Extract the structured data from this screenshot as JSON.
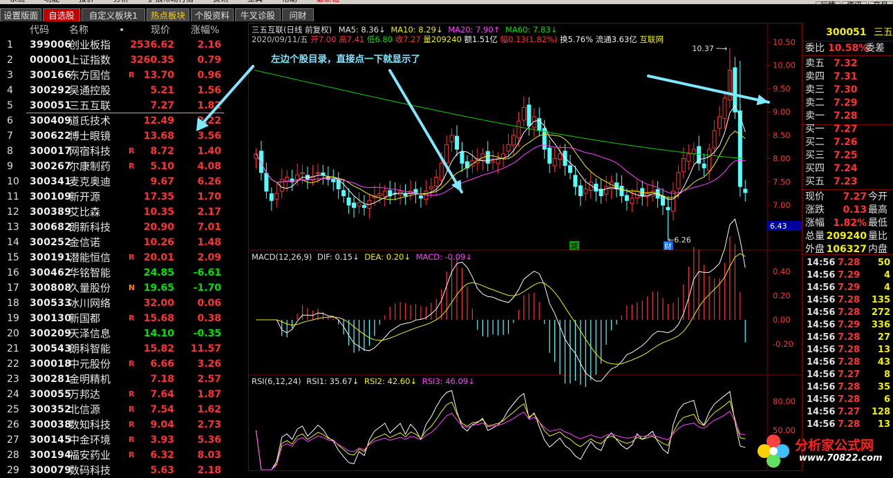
{
  "menu": {
    "items": [
      "系统",
      "功能",
      "报价",
      "分析",
      "扩展市场行情",
      "资讯",
      "工具",
      "帮助"
    ],
    "highlight": "最新通",
    "right_items": [
      "行情",
      "资讯",
      "交易"
    ]
  },
  "tabs": [
    "设置版面",
    "自选股",
    "自定义板块1",
    "热点板块",
    "个股资料",
    "牛叉诊股",
    "问财"
  ],
  "list": {
    "headers": {
      "code": "代码",
      "name": "名称",
      "dot": "•",
      "price": "现价",
      "chg": "涨幅%"
    },
    "rows": [
      {
        "no": "1",
        "code": "399006",
        "name": "创业板指",
        "flag": "",
        "price": "2536.62",
        "chg": "2.16",
        "dir": "up"
      },
      {
        "no": "2",
        "code": "000001",
        "name": "上证指数",
        "flag": "",
        "price": "3260.35",
        "chg": "0.79",
        "dir": "up"
      },
      {
        "no": "3",
        "code": "300166",
        "name": "东方国信",
        "flag": "R",
        "price": "13.70",
        "chg": "0.96",
        "dir": "up"
      },
      {
        "no": "4",
        "code": "300292",
        "name": "吴通控股",
        "flag": "",
        "price": "5.21",
        "chg": "1.56",
        "dir": "up"
      },
      {
        "no": "5",
        "code": "300051",
        "name": "三五互联",
        "flag": "",
        "price": "7.27",
        "chg": "1.82",
        "dir": "up"
      },
      {
        "no": "6",
        "code": "300409",
        "name": "道氏技术",
        "flag": "",
        "price": "12.49",
        "chg": "2.22",
        "dir": "up"
      },
      {
        "no": "7",
        "code": "300622",
        "name": "博士眼镜",
        "flag": "",
        "price": "13.68",
        "chg": "3.56",
        "dir": "up"
      },
      {
        "no": "8",
        "code": "300017",
        "name": "网宿科技",
        "flag": "R",
        "price": "8.72",
        "chg": "1.40",
        "dir": "up"
      },
      {
        "no": "9",
        "code": "300267",
        "name": "尔康制药",
        "flag": "R",
        "price": "5.10",
        "chg": "4.08",
        "dir": "up"
      },
      {
        "no": "10",
        "code": "300341",
        "name": "麦克奥迪",
        "flag": "",
        "price": "9.67",
        "chg": "6.26",
        "dir": "up"
      },
      {
        "no": "11",
        "code": "300109",
        "name": "新开源",
        "flag": "",
        "price": "17.35",
        "chg": "1.70",
        "dir": "up"
      },
      {
        "no": "12",
        "code": "300389",
        "name": "艾比森",
        "flag": "",
        "price": "10.35",
        "chg": "2.17",
        "dir": "up"
      },
      {
        "no": "13",
        "code": "300682",
        "name": "朗新科技",
        "flag": "",
        "price": "20.90",
        "chg": "7.01",
        "dir": "up"
      },
      {
        "no": "14",
        "code": "300252",
        "name": "金信诺",
        "flag": "",
        "price": "10.26",
        "chg": "1.48",
        "dir": "up"
      },
      {
        "no": "15",
        "code": "300191",
        "name": "潜能恒信",
        "flag": "R",
        "price": "20.01",
        "chg": "2.09",
        "dir": "up"
      },
      {
        "no": "16",
        "code": "300462",
        "name": "华铭智能",
        "flag": "",
        "price": "24.85",
        "chg": "-6.61",
        "dir": "down"
      },
      {
        "no": "17",
        "code": "300808",
        "name": "久量股份",
        "flag": "N",
        "price": "19.65",
        "chg": "-1.70",
        "dir": "down"
      },
      {
        "no": "18",
        "code": "300533",
        "name": "冰川网络",
        "flag": "",
        "price": "32.00",
        "chg": "0.06",
        "dir": "up"
      },
      {
        "no": "19",
        "code": "300130",
        "name": "新国都",
        "flag": "R",
        "price": "15.68",
        "chg": "0.38",
        "dir": "up"
      },
      {
        "no": "20",
        "code": "300209",
        "name": "天泽信息",
        "flag": "",
        "price": "14.10",
        "chg": "-0.35",
        "dir": "down"
      },
      {
        "no": "21",
        "code": "300543",
        "name": "朗科智能",
        "flag": "",
        "price": "15.82",
        "chg": "11.57",
        "dir": "up"
      },
      {
        "no": "22",
        "code": "300018",
        "name": "中元股份",
        "flag": "R",
        "price": "6.66",
        "chg": "3.26",
        "dir": "up"
      },
      {
        "no": "23",
        "code": "300281",
        "name": "金明精机",
        "flag": "",
        "price": "7.18",
        "chg": "2.57",
        "dir": "up"
      },
      {
        "no": "24",
        "code": "300055",
        "name": "万邦达",
        "flag": "R",
        "price": "7.64",
        "chg": "1.87",
        "dir": "up"
      },
      {
        "no": "25",
        "code": "300352",
        "name": "北信源",
        "flag": "R",
        "price": "7.54",
        "chg": "1.62",
        "dir": "up"
      },
      {
        "no": "26",
        "code": "300038",
        "name": "数知科技",
        "flag": "R",
        "price": "9.04",
        "chg": "2.73",
        "dir": "up"
      },
      {
        "no": "27",
        "code": "300145",
        "name": "中金环境",
        "flag": "R",
        "price": "3.93",
        "chg": "5.36",
        "dir": "up"
      },
      {
        "no": "28",
        "code": "300194",
        "name": "福安药业",
        "flag": "R",
        "price": "6.32",
        "chg": "8.03",
        "dir": "up"
      },
      {
        "no": "29",
        "code": "300079",
        "name": "数码科技",
        "flag": "",
        "price": "5.63",
        "chg": "2.18",
        "dir": "up"
      }
    ]
  },
  "chart": {
    "title": "三五互联(日线 前复权)",
    "ma5": "MA5: 8.36",
    "ma10": "MA10: 8.29",
    "ma20": "MA20: 7.90",
    "ma60": "MA60: 7.83",
    "info": {
      "date": "2020/09/11/五",
      "open": "开7.00",
      "high": "高7.41",
      "low": "低6.80",
      "close": "收7.27",
      "vol": "量209240",
      "amt": "额1.51亿",
      "amp": "幅0.13(1.82%)",
      "turn": "换5.76%",
      "float": "流通3.63亿",
      "concept": "互联网"
    },
    "annotation": "左边个股目录，直接点一下就显示了",
    "high_mark": "10.37",
    "low_mark": "6.26",
    "marker_cut": "减",
    "marker_fin": "财",
    "price_axis": [
      "10.50",
      "10.00",
      "9.50",
      "9.00",
      "8.50",
      "8.00",
      "7.50",
      "7.00"
    ],
    "cursor_price": "6.43",
    "macd": {
      "title": "MACD(12,26,9)",
      "dif": "DIF: 0.15",
      "dea": "DEA: 0.20",
      "macd": "MACD: -0.09",
      "axis": [
        "0.40",
        "0.20",
        "0.00",
        "-0.20"
      ]
    },
    "rsi": {
      "title": "RSI(6,12,24)",
      "r1": "RSI1: 35.67",
      "r2": "RSI2: 42.60",
      "r3": "RSI3: 46.09",
      "axis": [
        "80.00",
        "50.00"
      ]
    }
  },
  "panel": {
    "code": "300051",
    "name": "三五",
    "ratio_label": "委比",
    "ratio": "10.58%",
    "diff_label": "委差",
    "asks": [
      {
        "l": "卖五",
        "p": "7.32"
      },
      {
        "l": "卖四",
        "p": "7.31"
      },
      {
        "l": "卖三",
        "p": "7.30"
      },
      {
        "l": "卖二",
        "p": "7.29"
      },
      {
        "l": "卖一",
        "p": "7.28"
      }
    ],
    "bids": [
      {
        "l": "买一",
        "p": "7.27"
      },
      {
        "l": "买二",
        "p": "7.26"
      },
      {
        "l": "买三",
        "p": "7.25"
      },
      {
        "l": "买四",
        "p": "7.24"
      },
      {
        "l": "买五",
        "p": "7.23"
      }
    ],
    "stats": [
      {
        "l": "现价",
        "v": "7.27",
        "r": "今开"
      },
      {
        "l": "涨跌",
        "v": "0.13",
        "r": "最高"
      },
      {
        "l": "涨幅",
        "v": "1.82%",
        "r": "最低"
      },
      {
        "l": "总量",
        "v": "209240",
        "r": "量比"
      },
      {
        "l": "外盘",
        "v": "106327",
        "r": "内盘"
      }
    ],
    "ticks": [
      {
        "t": "14:56",
        "p": "7.28",
        "v": "50"
      },
      {
        "t": "14:56",
        "p": "7.29",
        "v": "4"
      },
      {
        "t": "14:56",
        "p": "7.29",
        "v": "4"
      },
      {
        "t": "14:56",
        "p": "7.28",
        "v": "135"
      },
      {
        "t": "14:56",
        "p": "7.28",
        "v": "272"
      },
      {
        "t": "14:56",
        "p": "7.29",
        "v": "336"
      },
      {
        "t": "14:56",
        "p": "7.28",
        "v": "27"
      },
      {
        "t": "14:56",
        "p": "7.28",
        "v": "13"
      },
      {
        "t": "14:56",
        "p": "7.28",
        "v": "43"
      },
      {
        "t": "14:56",
        "p": "7.27",
        "v": "8"
      },
      {
        "t": "14:56",
        "p": "7.28",
        "v": "35"
      },
      {
        "t": "14:56",
        "p": "7.28",
        "v": "6"
      },
      {
        "t": "14:56",
        "p": "7.27",
        "v": "128"
      },
      {
        "t": "14:56",
        "p": "7.28",
        "v": "13"
      }
    ]
  },
  "watermark": {
    "name": "分析家公式网",
    "url": "www.70822.com"
  },
  "colors": {
    "up": "#ff3232",
    "down": "#00e000",
    "bg": "#000000",
    "frame": "#800000",
    "arrow": "#7fe8ff"
  }
}
